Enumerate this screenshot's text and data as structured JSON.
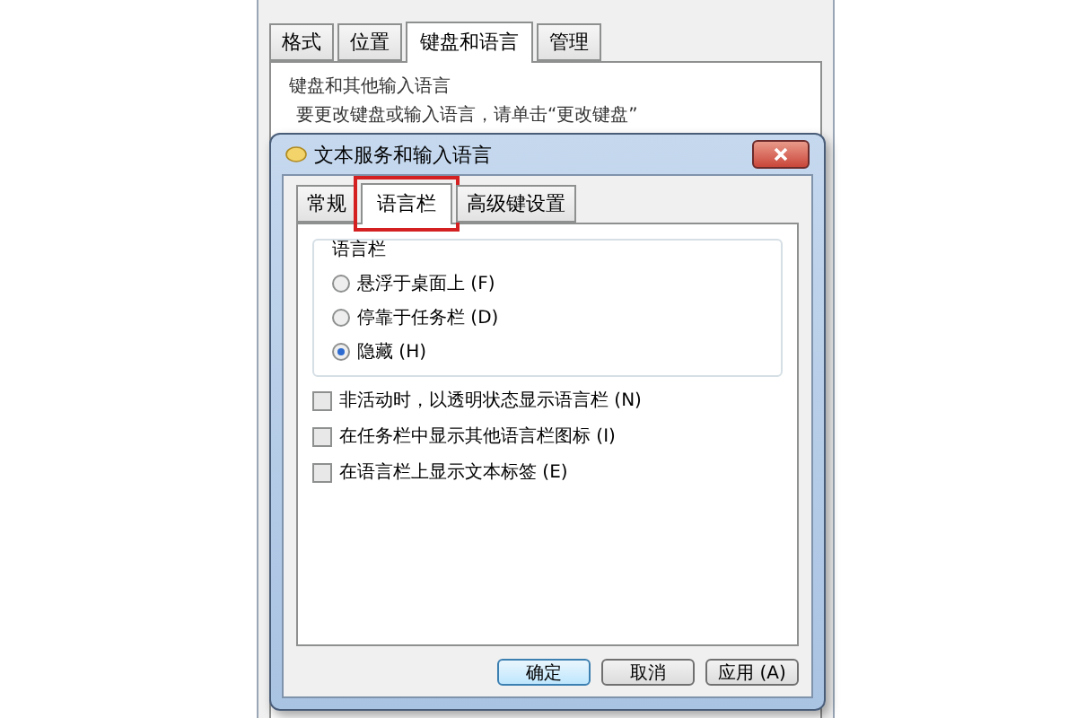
{
  "background_window": {
    "tabs": [
      {
        "label": "格式",
        "selected": false
      },
      {
        "label": "位置",
        "selected": false
      },
      {
        "label": "键盘和语言",
        "selected": true
      },
      {
        "label": "管理",
        "selected": false
      }
    ],
    "group_title": "键盘和其他输入语言",
    "instruction": "要更改键盘或输入语言，请单击“更改键盘”"
  },
  "dialog": {
    "title": "文本服务和输入语言",
    "tabs": [
      {
        "label": "常规",
        "selected": false,
        "highlighted": false
      },
      {
        "label": "语言栏",
        "selected": true,
        "highlighted": true
      },
      {
        "label": "高级键设置",
        "selected": false,
        "highlighted": false
      }
    ],
    "language_bar": {
      "title": "语言栏",
      "options": [
        {
          "label": "悬浮于桌面上 (F)",
          "selected": false
        },
        {
          "label": "停靠于任务栏 (D)",
          "selected": false
        },
        {
          "label": "隐藏 (H)",
          "selected": true
        }
      ]
    },
    "checkboxes": [
      {
        "label": "非活动时，以透明状态显示语言栏 (N)",
        "checked": false
      },
      {
        "label": "在任务栏中显示其他语言栏图标 (I)",
        "checked": false
      },
      {
        "label": "在语言栏上显示文本标签 (E)",
        "checked": false
      }
    ],
    "buttons": [
      {
        "label": "确定",
        "kind": "default"
      },
      {
        "label": "取消",
        "kind": "normal"
      },
      {
        "label": "应用 (A)",
        "kind": "normal"
      }
    ]
  }
}
